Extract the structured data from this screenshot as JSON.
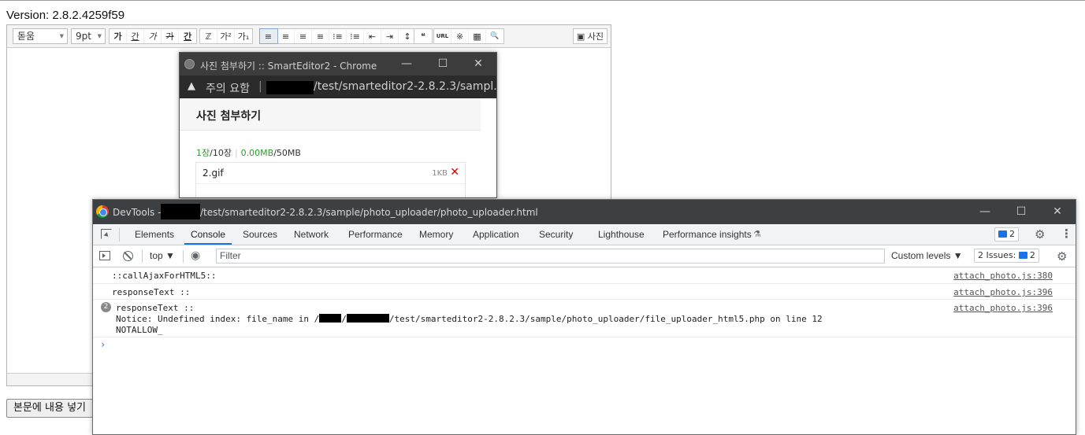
{
  "page": {
    "version": "Version: 2.8.2.4259f59",
    "insert_button": "본문에 내용 넣기"
  },
  "editor": {
    "font_select": "돋움",
    "size_select": "9pt",
    "format_buttons": [
      "가",
      "간",
      "가",
      "가",
      "간"
    ],
    "color_buttons": [
      "ℤ",
      "가²",
      "가₁"
    ],
    "align_buttons": [
      "≡",
      "≡",
      "≡",
      "≡",
      "⁝≡",
      "⁝≡",
      "⇤",
      "⇥",
      "↕"
    ],
    "misc_buttons": [
      "❝",
      "URL",
      "※",
      "▦",
      "🔍"
    ],
    "photo_button": "사진"
  },
  "popup": {
    "window_title": "사진 첨부하기 :: SmartEditor2 - Chrome",
    "warning_label": "주의 요함",
    "url_sep": "|",
    "url_path": "/test/smarteditor2-2.8.2.3/sampl...",
    "heading": "사진 첨부하기",
    "count_current": "1장",
    "count_total": "/10장",
    "size_current": "0.00MB",
    "size_total": "/50MB",
    "file_name": "2.gif",
    "file_size": "1KB",
    "delete_symbol": "✕"
  },
  "devtools": {
    "title_prefix": "DevTools -",
    "title_path": "/test/smarteditor2-2.8.2.3/sample/photo_uploader/photo_uploader.html",
    "tabs": [
      "Elements",
      "Console",
      "Sources",
      "Network",
      "Performance",
      "Memory",
      "Application",
      "Security",
      "Lighthouse",
      "Performance insights"
    ],
    "active_tab": "Console",
    "messages_badge": "2",
    "context": "top ▼",
    "filter_placeholder": "Filter",
    "custom_levels": "Custom levels ▼",
    "issues_label": "2 Issues:",
    "issues_count": "2",
    "logs": [
      {
        "text": "::callAjaxForHTML5::",
        "source": "attach_photo.js:380"
      },
      {
        "text": "responseText ::",
        "source": "attach_photo.js:396"
      },
      {
        "count": "2",
        "line1": "responseText ::",
        "line2a": "Notice: Undefined index: file_name in /",
        "line2b": "/",
        "line2c": "/test/smarteditor2-2.8.2.3/sample/photo_uploader/file_uploader_html5.php on line 12",
        "line3": "NOTALLOW_",
        "source": "attach_photo.js:396"
      }
    ],
    "prompt": "›"
  }
}
